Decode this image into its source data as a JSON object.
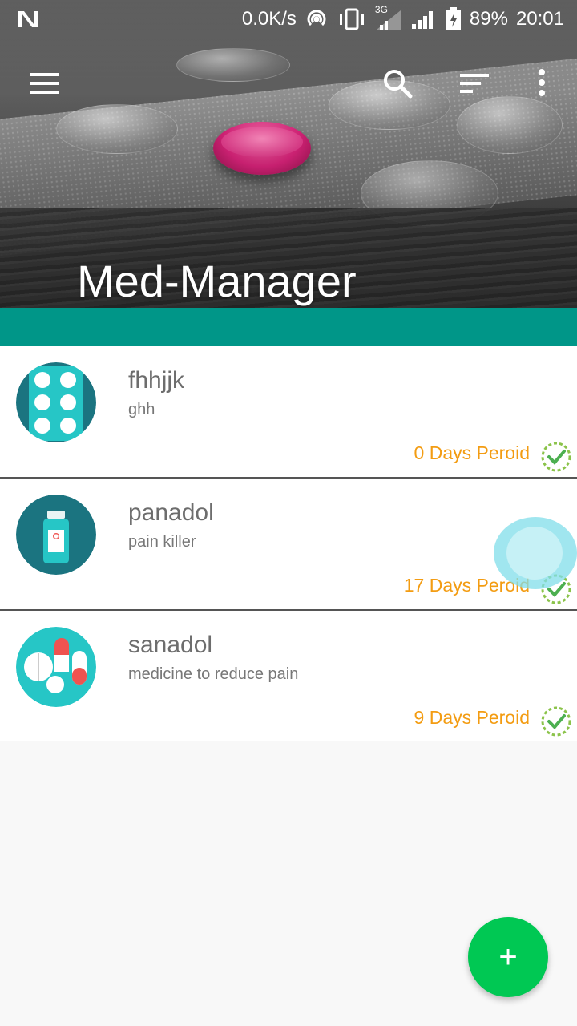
{
  "status_bar": {
    "network_speed": "0.0K/s",
    "network_type": "3G",
    "battery": "89%",
    "time": "20:01"
  },
  "app": {
    "title": "Med-Manager",
    "accent": "#009688"
  },
  "medicines": [
    {
      "name": "fhhjjk",
      "description": "ghh",
      "period": "0 Days Peroid",
      "icon": "pill-blister-icon"
    },
    {
      "name": "panadol",
      "description": "pain killer",
      "period": "17 Days Peroid",
      "icon": "medicine-bottle-icon"
    },
    {
      "name": "sanadol",
      "description": "medicine to reduce pain",
      "period": "9 Days Peroid",
      "icon": "capsules-icon"
    }
  ],
  "fab": {
    "label": "+"
  }
}
